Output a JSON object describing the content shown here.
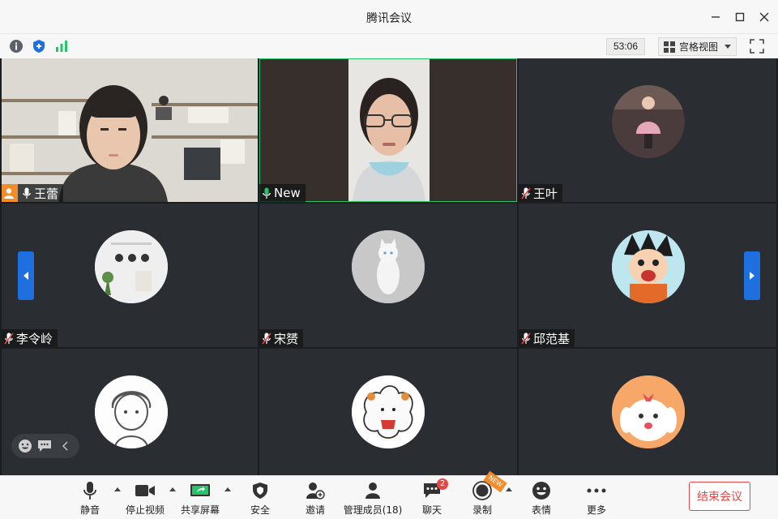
{
  "window": {
    "title": "腾讯会议"
  },
  "infobar": {
    "timer": "53:06",
    "view_label": "宫格视图"
  },
  "participants": [
    {
      "name": "王蕾",
      "mic": "on",
      "host": true,
      "video": true
    },
    {
      "name": "New",
      "mic": "on",
      "host": false,
      "video": true
    },
    {
      "name": "王叶",
      "mic": "muted",
      "host": false,
      "video": false
    },
    {
      "name": "李令岭",
      "mic": "muted",
      "host": false,
      "video": false
    },
    {
      "name": "宋赟",
      "mic": "muted",
      "host": false,
      "video": false
    },
    {
      "name": "邱范基",
      "mic": "muted",
      "host": false,
      "video": false
    },
    {
      "name": "",
      "mic": "",
      "host": false,
      "video": false
    },
    {
      "name": "",
      "mic": "",
      "host": false,
      "video": false
    },
    {
      "name": "",
      "mic": "",
      "host": false,
      "video": false
    }
  ],
  "toolbar": {
    "mute": "静音",
    "stop_video": "停止视频",
    "share_screen": "共享屏幕",
    "security": "安全",
    "invite": "邀请",
    "manage_members": "管理成员(18)",
    "chat": "聊天",
    "chat_badge": "2",
    "record": "录制",
    "record_tag": "NEW",
    "reactions": "表情",
    "more": "更多",
    "end_meeting": "结束会议"
  },
  "colors": {
    "accent": "#1e6fe0",
    "active_speaker": "#25c36a",
    "host_badge": "#f08c2a",
    "danger": "#e84545"
  }
}
